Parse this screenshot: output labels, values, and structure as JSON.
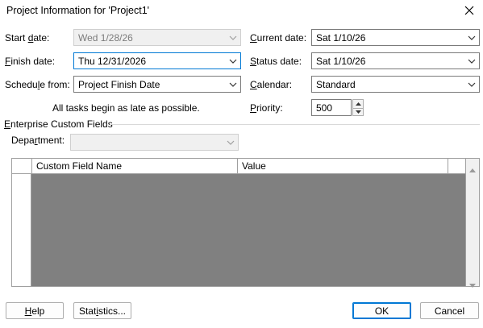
{
  "dialog": {
    "title": "Project Information for 'Project1'"
  },
  "fields": {
    "start_date": {
      "label_pre": "Start ",
      "label_key": "d",
      "label_post": "ate:",
      "value": "Wed 1/28/26"
    },
    "finish_date": {
      "label_pre": "",
      "label_key": "F",
      "label_post": "inish date:",
      "value": "Thu 12/31/2026"
    },
    "schedule_from": {
      "label_pre": "Schedu",
      "label_key": "l",
      "label_post": "e from:",
      "value": "Project Finish Date"
    },
    "current_date": {
      "label_pre": "",
      "label_key": "C",
      "label_post": "urrent date:",
      "value": "Sat 1/10/26"
    },
    "status_date": {
      "label_pre": "",
      "label_key": "S",
      "label_post": "tatus date:",
      "value": "Sat 1/10/26"
    },
    "calendar": {
      "label_pre": "",
      "label_key": "C",
      "label_post": "alendar:",
      "value": "Standard"
    },
    "priority": {
      "label_pre": "",
      "label_key": "P",
      "label_post": "riority:",
      "value": "500"
    }
  },
  "schedule_note": "All tasks begin as late as possible.",
  "enterprise": {
    "section_pre": "",
    "section_key": "E",
    "section_post": "nterprise Custom Fields",
    "department_pre": "Depa",
    "department_key": "r",
    "department_post": "tment:",
    "department_value": ""
  },
  "grid": {
    "columns": [
      "Custom Field Name",
      "Value"
    ]
  },
  "buttons": {
    "help_key": "H",
    "help_post": "elp",
    "stats_pre": "Stat",
    "stats_key": "i",
    "stats_post": "stics...",
    "ok": "OK",
    "cancel": "Cancel"
  },
  "colors": {
    "accent": "#0078d4",
    "grid_fill": "#808080"
  }
}
